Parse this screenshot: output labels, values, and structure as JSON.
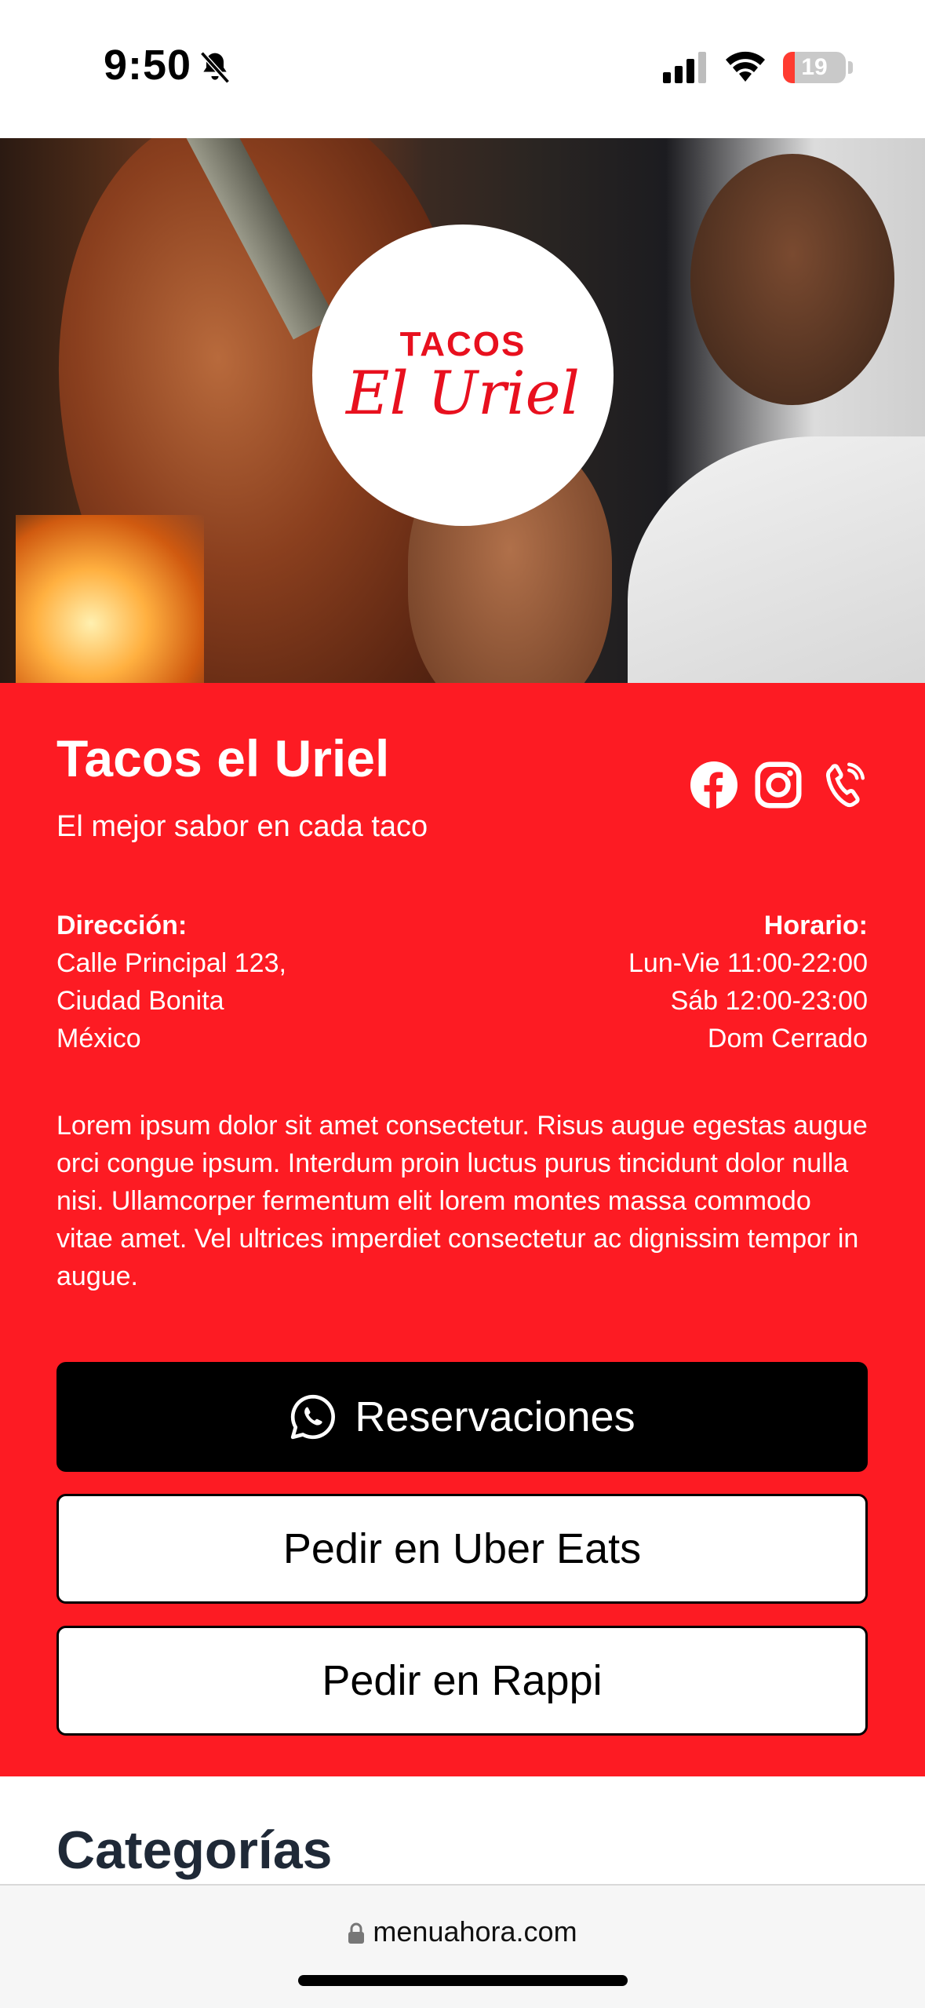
{
  "status": {
    "time": "9:50",
    "battery": "19",
    "battery_level": 0.19
  },
  "hero": {
    "logo_top": "TACOS",
    "logo_name": "El Uriel"
  },
  "restaurant": {
    "name": "Tacos el Uriel",
    "tagline": "El mejor sabor en cada taco",
    "address_label": "Dirección:",
    "address_lines": [
      "Calle Principal 123,",
      "Ciudad Bonita",
      "México"
    ],
    "hours_label": "Horario:",
    "hours_lines": [
      "Lun-Vie 11:00-22:00",
      "Sáb 12:00-23:00",
      "Dom Cerrado"
    ],
    "description": "Lorem ipsum dolor sit amet consectetur. Risus augue egestas augue orci congue ipsum. Interdum proin luctus purus tincidunt dolor nulla nisi. Ullamcorper fermentum elit lorem montes massa commodo vitae amet. Vel ultrices imperdiet consectetur ac dignissim tempor in augue."
  },
  "social_icons": [
    "facebook-icon",
    "instagram-icon",
    "phone-icon"
  ],
  "buttons": {
    "reserve": "Reservaciones",
    "uber": "Pedir en Uber Eats",
    "rappi": "Pedir en Rappi"
  },
  "categories": {
    "title": "Categorías"
  },
  "browser": {
    "url": "menuahora.com"
  },
  "colors": {
    "accent": "#fd1b23",
    "logo_red": "#e8101e",
    "button_dark": "#000000"
  }
}
